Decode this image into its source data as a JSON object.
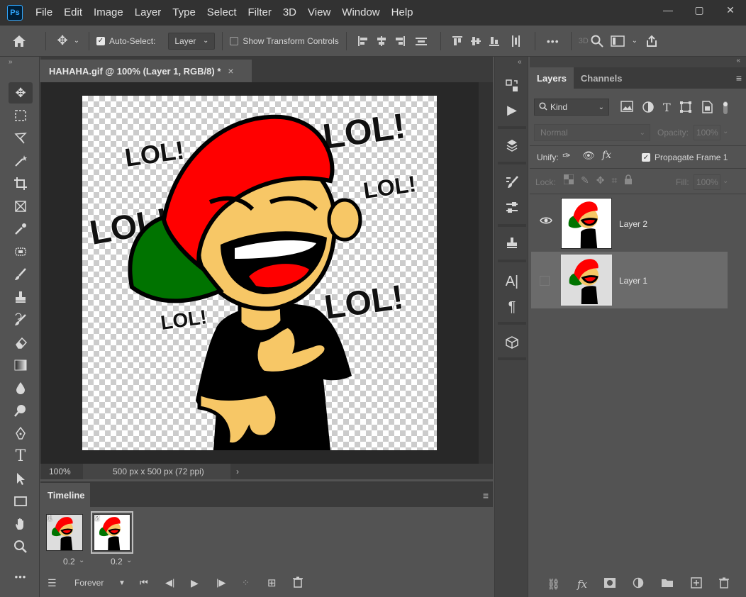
{
  "app": {
    "logo": "Ps"
  },
  "menu": [
    "File",
    "Edit",
    "Image",
    "Layer",
    "Type",
    "Select",
    "Filter",
    "3D",
    "View",
    "Window",
    "Help"
  ],
  "window_controls": {
    "minimize": "—",
    "restore": "▢",
    "close": "✕"
  },
  "options": {
    "auto_select_label": "Auto-Select:",
    "auto_select_value": "Layer",
    "show_transform_label": "Show Transform Controls",
    "more": "•••",
    "three_d": "3D"
  },
  "document": {
    "tab_title": "HAHAHA.gif @ 100% (Layer 1, RGB/8) *",
    "tab_close": "×",
    "zoom": "100%",
    "dimensions": "500 px x 500 px (72 ppi)",
    "status_arrow": "›"
  },
  "artwork": {
    "texts": [
      "LOL!",
      "LOL!",
      "LOL!",
      "LOL!",
      "LOL!",
      "LOL!"
    ],
    "colors": {
      "cap": "#ff0000",
      "brim": "#007300",
      "skin": "#f7c766",
      "shirt": "#000000",
      "tongue": "#ff0000"
    }
  },
  "timeline": {
    "title": "Timeline",
    "frames": [
      {
        "number": "1",
        "delay": "0.2"
      },
      {
        "number": "2",
        "delay": "0.2"
      }
    ],
    "loop": "Forever"
  },
  "layers_panel": {
    "tabs": [
      "Layers",
      "Channels"
    ],
    "filter_kind": "Kind",
    "blend_mode": "Normal",
    "opacity_label": "Opacity:",
    "opacity_value": "100%",
    "unify_label": "Unify:",
    "propagate_label": "Propagate Frame 1",
    "lock_label": "Lock:",
    "fill_label": "Fill:",
    "fill_value": "100%",
    "layers": [
      {
        "name": "Layer 2",
        "visible": true,
        "selected": false
      },
      {
        "name": "Layer 1",
        "visible": false,
        "selected": true
      }
    ]
  }
}
